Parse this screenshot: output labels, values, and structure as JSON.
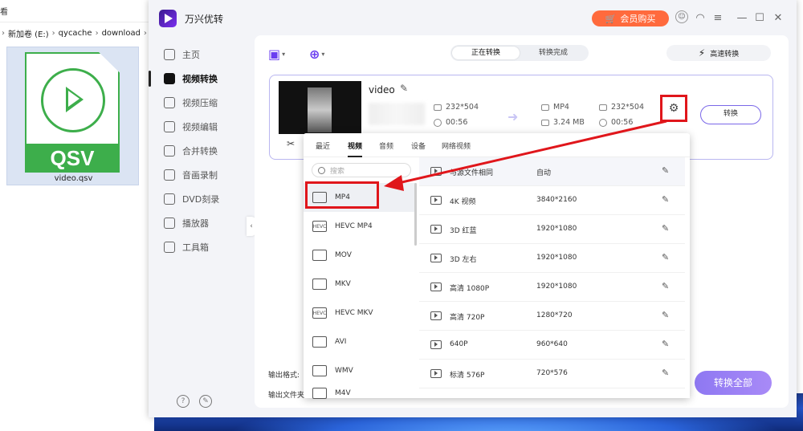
{
  "explorer": {
    "view_label": "看",
    "breadcrumb": [
      "新加卷 (E:)",
      "qycache",
      "download"
    ],
    "file": {
      "type_label": "QSV",
      "name": "video.qsv"
    }
  },
  "app": {
    "title": "万兴优转",
    "buy_label": "会员购买",
    "icons": [
      "avatar-icon",
      "headset-icon",
      "menu-icon",
      "minimize-icon",
      "maximize-icon",
      "close-icon"
    ]
  },
  "sidebar": {
    "items": [
      {
        "label": "主页",
        "icon": "home-icon",
        "active": false
      },
      {
        "label": "视频转换",
        "icon": "convert-icon",
        "active": true
      },
      {
        "label": "视频压缩",
        "icon": "compress-icon",
        "active": false
      },
      {
        "label": "视频编辑",
        "icon": "scissors-icon",
        "active": false
      },
      {
        "label": "合并转换",
        "icon": "merge-icon",
        "active": false
      },
      {
        "label": "音画录制",
        "icon": "record-icon",
        "active": false
      },
      {
        "label": "DVD刻录",
        "icon": "dvd-icon",
        "active": false
      },
      {
        "label": "播放器",
        "icon": "player-icon",
        "active": false
      },
      {
        "label": "工具箱",
        "icon": "toolbox-icon",
        "active": false
      }
    ]
  },
  "main": {
    "tabs": [
      {
        "label": "正在转换",
        "selected": true
      },
      {
        "label": "转换完成",
        "selected": false
      }
    ],
    "high_speed_label": "高速转换",
    "card": {
      "name": "video",
      "src_resolution": "232*504",
      "src_duration": "00:56",
      "dst_format": "MP4",
      "dst_size": "3.24 MB",
      "dst_resolution": "232*504",
      "dst_duration": "00:56",
      "convert_label": "转换"
    },
    "output_format_label": "输出格式:",
    "output_dir_label": "输出文件夹",
    "convert_all_label": "转换全部"
  },
  "dropdown": {
    "tabs": [
      {
        "label": "最近",
        "selected": false
      },
      {
        "label": "视频",
        "selected": true
      },
      {
        "label": "音频",
        "selected": false
      },
      {
        "label": "设备",
        "selected": false
      },
      {
        "label": "网络视频",
        "selected": false
      }
    ],
    "search_placeholder": "搜索",
    "formats": [
      {
        "label": "MP4",
        "badge": "",
        "selected": true
      },
      {
        "label": "HEVC MP4",
        "badge": "HEVC",
        "selected": false
      },
      {
        "label": "MOV",
        "badge": "",
        "selected": false
      },
      {
        "label": "MKV",
        "badge": "",
        "selected": false
      },
      {
        "label": "HEVC MKV",
        "badge": "HEVC",
        "selected": false
      },
      {
        "label": "AVI",
        "badge": "",
        "selected": false
      },
      {
        "label": "WMV",
        "badge": "",
        "selected": false
      },
      {
        "label": "M4V",
        "badge": "",
        "selected": false
      }
    ],
    "presets": [
      {
        "name": "与源文件相同",
        "resolution": "自动",
        "selected": true
      },
      {
        "name": "4K 视频",
        "resolution": "3840*2160",
        "selected": false
      },
      {
        "name": "3D 红蓝",
        "resolution": "1920*1080",
        "selected": false
      },
      {
        "name": "3D 左右",
        "resolution": "1920*1080",
        "selected": false
      },
      {
        "name": "高清 1080P",
        "resolution": "1920*1080",
        "selected": false
      },
      {
        "name": "高清 720P",
        "resolution": "1280*720",
        "selected": false
      },
      {
        "name": "640P",
        "resolution": "960*640",
        "selected": false
      },
      {
        "name": "标清 576P",
        "resolution": "720*576",
        "selected": false
      }
    ]
  },
  "colors": {
    "accent": "#7a67e8",
    "highlight": "#e0161b",
    "buy": "#ff6a3d",
    "file_green": "#3dae4b"
  }
}
